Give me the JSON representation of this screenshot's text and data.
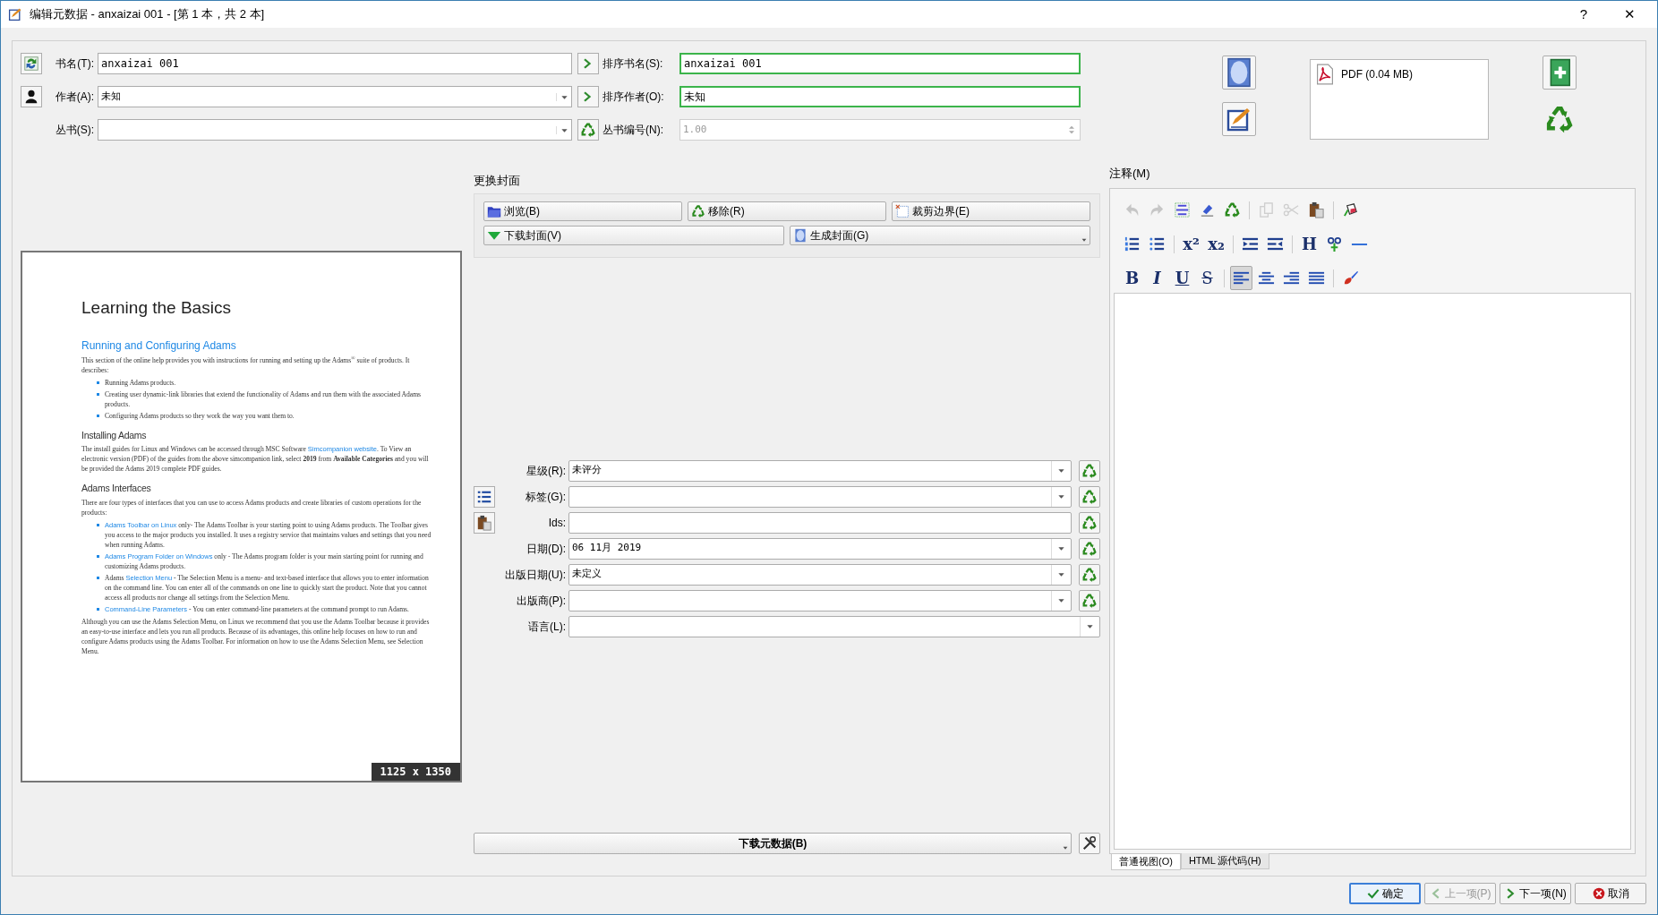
{
  "window": {
    "title": "编辑元数据 - anxaizai 001 - [第 1 本，共 2 本]",
    "help": "?",
    "close": "✕"
  },
  "basic_rows": [
    {
      "label": "书名(T):",
      "value": "anxaizai 001",
      "sort_label": "排序书名(S):",
      "sort_value": "anxaizai 001"
    },
    {
      "label": "作者(A):",
      "value": "未知",
      "sort_label": "排序作者(O):",
      "sort_value": "未知"
    },
    {
      "label": "丛书(S):",
      "sort_label": "丛书编号(N):",
      "sort_value": "1.00"
    }
  ],
  "formats": [
    {
      "label": "PDF (0.04 MB)"
    }
  ],
  "cover": {
    "heading": "更换封面",
    "buttons": [
      {
        "label": "浏览(B)",
        "menu": false
      },
      {
        "label": "移除(R)",
        "menu": false
      },
      {
        "label": "裁剪边界(E)",
        "menu": false
      },
      {
        "label": "下载封面(V)",
        "menu": false
      },
      {
        "label": "生成封面(G)",
        "menu": true
      }
    ],
    "size": "1125 x 1350",
    "page": [
      {
        "kind": "h1",
        "parts": [
          {
            "kind": "text",
            "text": "Learning the Basics"
          }
        ]
      },
      {
        "kind": "h2",
        "parts": [
          {
            "kind": "text",
            "text": "Running and Configuring Adams"
          }
        ]
      },
      {
        "kind": "p",
        "parts": [
          {
            "kind": "text",
            "text": "This section of the online help provides you with instructions for running and setting up the Adams$^{®}$ suite of products. It describes:"
          }
        ]
      },
      {
        "kind": "ul",
        "items": [
          [
            {
              "kind": "text",
              "text": "Running Adams products."
            }
          ],
          [
            {
              "kind": "text",
              "text": "Creating user dynamic-link libraries that extend the functionality of Adams and run them with the associated Adams products."
            }
          ],
          [
            {
              "kind": "text",
              "text": "Configuring Adams products so they work the way you want them to."
            }
          ]
        ]
      },
      {
        "kind": "h3",
        "parts": [
          {
            "kind": "text",
            "text": "Installing Adams"
          }
        ]
      },
      {
        "kind": "p",
        "parts": [
          {
            "kind": "text",
            "text": "The install guides for Linux and Windows can be accessed through MSC Software "
          },
          {
            "kind": "link",
            "text": "Simcompanion website"
          },
          {
            "kind": "text",
            "text": ". To View an electronic version (PDF) of the guides from the above simcompanion link, select **2019** from **Available Categories** and you will be provided the Adams 2019 complete PDF guides."
          }
        ]
      },
      {
        "kind": "h3",
        "parts": [
          {
            "kind": "text",
            "text": "Adams Interfaces"
          }
        ]
      },
      {
        "kind": "p",
        "parts": [
          {
            "kind": "text",
            "text": "There are four types of interfaces that you can use to access Adams products and create libraries of custom operations for the products:"
          }
        ]
      },
      {
        "kind": "ul",
        "items": [
          [
            {
              "kind": "link",
              "text": "Adams Toolbar on Linux"
            },
            {
              "kind": "text",
              "text": " only- The Adams Toolbar is your starting point to using Adams products. The Toolbar gives you access to the major products you installed. It uses a registry service that maintains values and settings that you need when running Adams."
            }
          ],
          [
            {
              "kind": "link",
              "text": "Adams Program Folder on Windows"
            },
            {
              "kind": "text",
              "text": " only - The Adams program folder is your main starting point for running and customizing Adams products."
            }
          ],
          [
            {
              "kind": "text",
              "text": "Adams "
            },
            {
              "kind": "link",
              "text": "Selection Menu"
            },
            {
              "kind": "text",
              "text": " - The Selection Menu is a menu- and text-based interface that allows you to enter information on the command line. You can enter all of the commands on one line to quickly start the product. Note that you cannot access all products nor change all settings from the Selection Menu."
            }
          ],
          [
            {
              "kind": "link",
              "text": "Command-Line Parameters"
            },
            {
              "kind": "text",
              "text": " - You can enter command-line parameters at the command prompt to run Adams."
            }
          ]
        ]
      },
      {
        "kind": "p",
        "parts": [
          {
            "kind": "text",
            "text": "Although you can use the Adams Selection Menu, on Linux we recommend that you use the Adams Toolbar because it provides an easy-to-use interface and lets you run all products. Because of its advantages, this online help focuses on how to run and configure Adams products using the Adams Toolbar. For information on how to use the Adams Selection Menu, see Selection Menu."
          }
        ]
      }
    ]
  },
  "fields": [
    {
      "label": "星级(R):",
      "value": "未评分",
      "kind": "combo",
      "reset": true
    },
    {
      "label": "标签(G):",
      "kind": "combo",
      "reset": true
    },
    {
      "label": "Ids:",
      "kind": "text",
      "reset": true
    },
    {
      "label": "日期(D):",
      "value": "06 11月 2019",
      "kind": "combo",
      "reset": true
    },
    {
      "label": "出版日期(U):",
      "value": "未定义",
      "kind": "combo",
      "reset": true
    },
    {
      "label": "出版商(P):",
      "kind": "combo",
      "reset": true
    },
    {
      "label": "语言(L):",
      "kind": "combo",
      "reset": false
    }
  ],
  "metadata_button": {
    "label": "下载元数据(B)"
  },
  "notes": {
    "label": "注释(M)",
    "toolbar": [
      [
        {
          "kind": "undo",
          "disabled": true,
          "selected": false
        },
        {
          "kind": "redo",
          "disabled": true,
          "selected": false
        },
        {
          "kind": "select",
          "disabled": false,
          "selected": false
        },
        {
          "kind": "eraser",
          "disabled": false,
          "selected": false
        },
        {
          "kind": "recycle",
          "disabled": false,
          "selected": false
        },
        {
          "kind": "sep"
        },
        {
          "kind": "copy",
          "disabled": true,
          "selected": false
        },
        {
          "kind": "cut",
          "disabled": true,
          "selected": false
        },
        {
          "kind": "paste",
          "disabled": false,
          "selected": false
        },
        {
          "kind": "sep"
        },
        {
          "kind": "bucket",
          "disabled": false,
          "selected": false
        }
      ],
      [
        {
          "kind": "ol",
          "disabled": false,
          "selected": false
        },
        {
          "kind": "ul",
          "disabled": false,
          "selected": false
        },
        {
          "kind": "sep"
        },
        {
          "kind": "glyph",
          "glyph": "x²",
          "disabled": false,
          "selected": false
        },
        {
          "kind": "glyph",
          "glyph": "x₂",
          "disabled": false,
          "selected": false
        },
        {
          "kind": "sep"
        },
        {
          "kind": "indent",
          "disabled": false,
          "selected": false
        },
        {
          "kind": "outdent",
          "disabled": false,
          "selected": false
        },
        {
          "kind": "sep"
        },
        {
          "kind": "glyph",
          "glyph": "H",
          "disabled": false,
          "selected": false
        },
        {
          "kind": "link",
          "disabled": false,
          "selected": false
        },
        {
          "kind": "hr",
          "disabled": false,
          "selected": false
        }
      ],
      [
        {
          "kind": "glyph",
          "glyph": "B",
          "disabled": false,
          "selected": false
        },
        {
          "kind": "glyph-i",
          "glyph": "I",
          "disabled": false,
          "selected": false
        },
        {
          "kind": "glyph-u",
          "glyph": "U",
          "disabled": false,
          "selected": false
        },
        {
          "kind": "glyph-s",
          "glyph": "S",
          "disabled": false,
          "selected": false
        },
        {
          "kind": "sep"
        },
        {
          "kind": "align-left",
          "disabled": false,
          "selected": true
        },
        {
          "kind": "align-center",
          "disabled": false,
          "selected": false
        },
        {
          "kind": "align-right",
          "disabled": false,
          "selected": false
        },
        {
          "kind": "justify",
          "disabled": false,
          "selected": false
        },
        {
          "kind": "sep"
        },
        {
          "kind": "brush",
          "disabled": false,
          "selected": false
        }
      ]
    ],
    "tabs": [
      {
        "label": "普通视图(O)",
        "selected": true
      },
      {
        "label": "HTML 源代码(H)",
        "selected": false
      }
    ]
  },
  "footer_buttons": [
    {
      "label": "确定",
      "disabled": false,
      "default": true
    },
    {
      "label": "上一项(P)",
      "disabled": true,
      "default": false
    },
    {
      "label": "下一项(N)",
      "disabled": false,
      "default": false
    },
    {
      "label": "取消",
      "disabled": false,
      "default": false
    }
  ]
}
